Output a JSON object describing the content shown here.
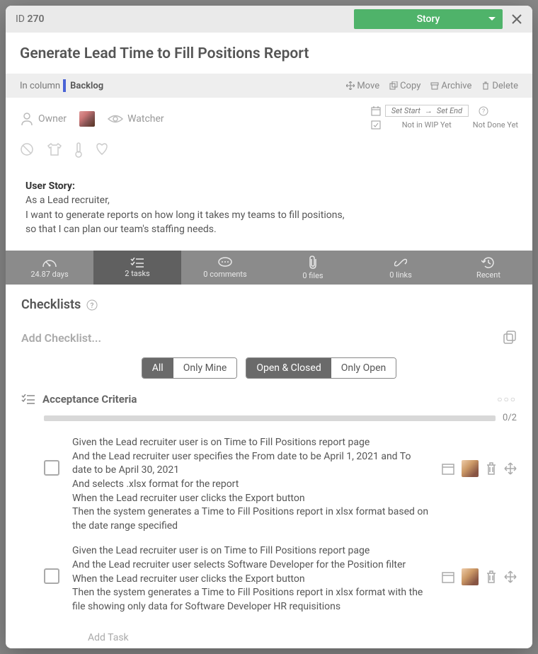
{
  "header": {
    "idLabel": "ID",
    "idValue": "270",
    "storyLabel": "Story"
  },
  "title": "Generate Lead Time to Fill Positions Report",
  "columnRow": {
    "inColumn": "In column",
    "column": "Backlog",
    "move": "Move",
    "copy": "Copy",
    "archive": "Archive",
    "delete": "Delete"
  },
  "owner": "Owner",
  "watcher": "Watcher",
  "schedule": {
    "setStart": "Set Start",
    "setEnd": "Set End",
    "notWip": "Not in WIP Yet",
    "notDone": "Not Done Yet"
  },
  "description": {
    "heading": "User Story:",
    "line1": "As a Lead recruiter,",
    "line2": "I want to generate reports on how long it takes my teams to fill positions,",
    "line3": "so that I can plan our team's staffing needs."
  },
  "tabs": {
    "days": "24.87 days",
    "tasks": "2 tasks",
    "comments": "0 comments",
    "files": "0 files",
    "links": "0 links",
    "recent": "Recent"
  },
  "checklistsHeader": "Checklists",
  "addChecklist": "Add Checklist...",
  "filterGroup1": {
    "all": "All",
    "mine": "Only Mine"
  },
  "filterGroup2": {
    "openClosed": "Open & Closed",
    "onlyOpen": "Only Open"
  },
  "acceptance": {
    "title": "Acceptance Criteria",
    "progress": "0/2",
    "tasks": [
      "Given the Lead recruiter user is on Time to Fill Positions report page\nAnd the Lead recruiter user specifies the From date to be April 1, 2021 and To date to be April 30, 2021\nAnd selects .xlsx format for the report\nWhen the Lead recruiter user clicks the Export button\nThen the system generates a Time to Fill Positions report in xlsx format based on the date range specified",
      "Given the Lead recruiter user is on Time to Fill Positions report page\nAnd the Lead recruiter user selects Software Developer for the Position filter\nWhen the Lead recruiter user clicks the Export button\nThen the system generates a Time to Fill Positions report in xlsx format with the file showing only data for Software Developer HR requisitions"
    ],
    "addTask": "Add Task"
  }
}
